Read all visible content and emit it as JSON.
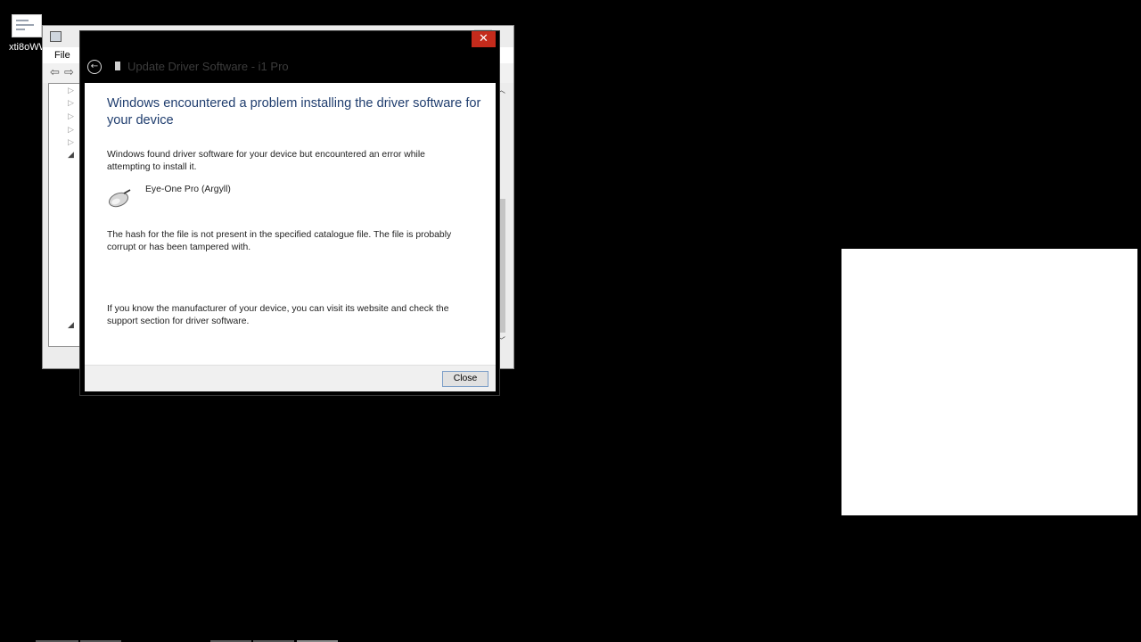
{
  "desktop": {
    "icon_label": "xti8oWW"
  },
  "background_window": {
    "menu_file": "File",
    "nav_back": "⇦",
    "nav_forward": "⇨"
  },
  "dialog": {
    "close_glyph": "✕",
    "back_glyph": "←",
    "title": "Update Driver Software - i1 Pro",
    "heading": "Windows encountered a problem installing the driver software for your device",
    "intro": "Windows found driver software for your device but encountered an error while attempting to install it.",
    "device_name": "Eye-One Pro (Argyll)",
    "error_message": "The hash for the file is not present in the specified catalogue file. The file is probably corrupt or has been tampered with.",
    "help_text": "If you know the manufacturer of your device, you can visit its website and check the support section for driver software.",
    "close_button": "Close"
  },
  "colors": {
    "desktop_bg": "#000000",
    "heading": "#1f3d6e",
    "close_red": "#c42b1c",
    "button_border": "#7a9dc7"
  },
  "icons": [
    "device-manager-icon",
    "back-arrow-icon",
    "forward-arrow-icon",
    "back-circle-icon",
    "device-icon",
    "mouse-device-icon",
    "close-icon"
  ]
}
